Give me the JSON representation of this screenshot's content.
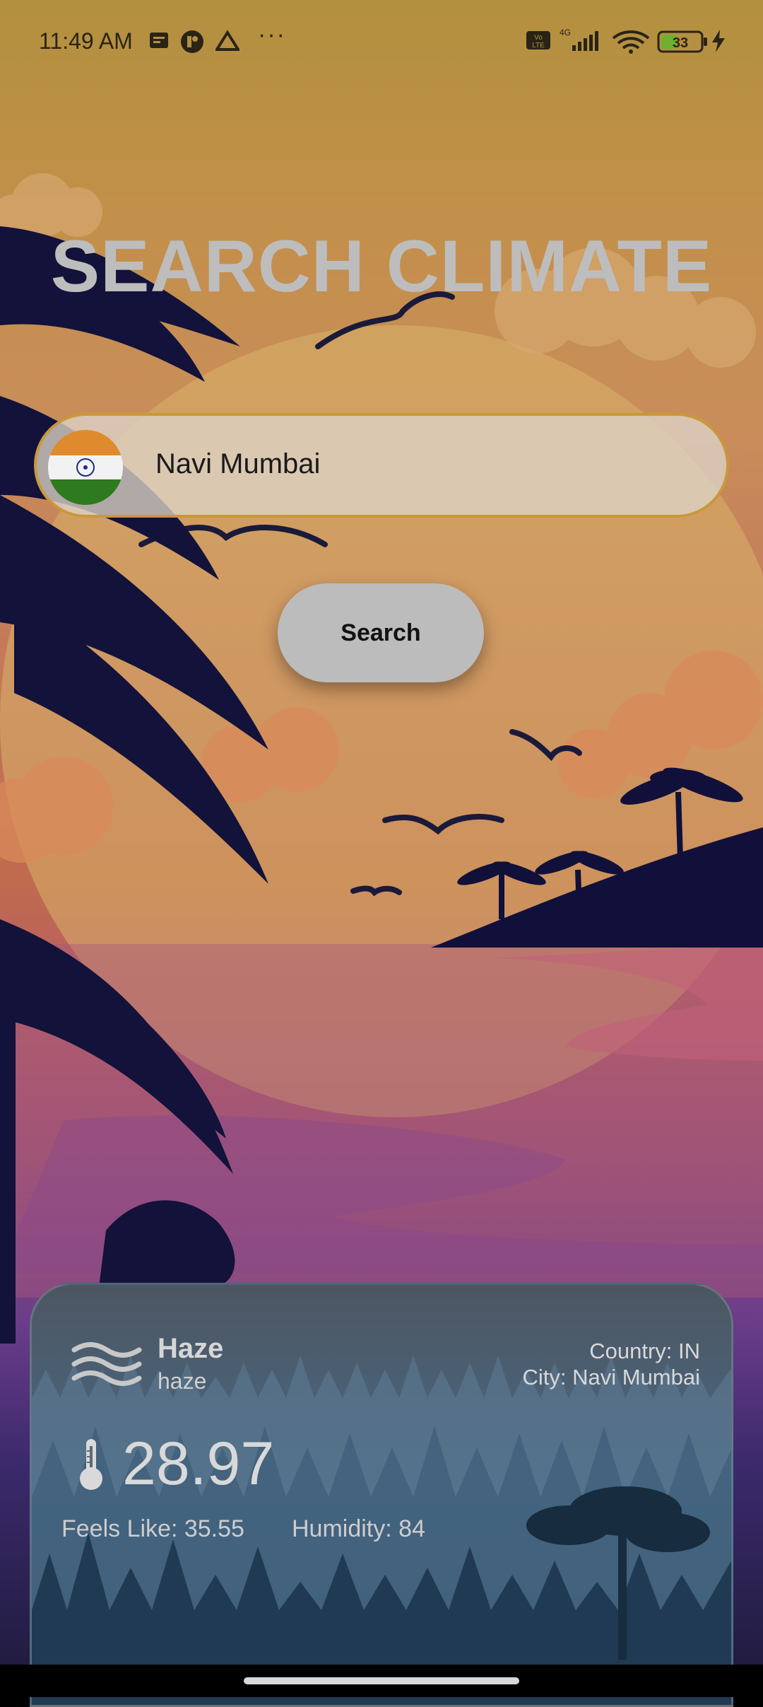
{
  "status_bar": {
    "time": "11:49 AM",
    "battery": "33",
    "network": "4G",
    "volte": "Vo LTE"
  },
  "title": "SEARCH CLIMATE",
  "search": {
    "value": "Navi Mumbai",
    "button_label": "Search",
    "flag_icon": "india-flag-icon"
  },
  "weather": {
    "condition": "Haze",
    "description": "haze",
    "country": "Country: IN",
    "city": "City: Navi Mumbai",
    "temperature": "28.97",
    "feels_like": "Feels Like: 35.55",
    "humidity": "Humidity: 84"
  },
  "colors": {
    "title": "#bdbdbd",
    "search_border": "#c8983a",
    "button_bg": "#bcbcbc"
  }
}
